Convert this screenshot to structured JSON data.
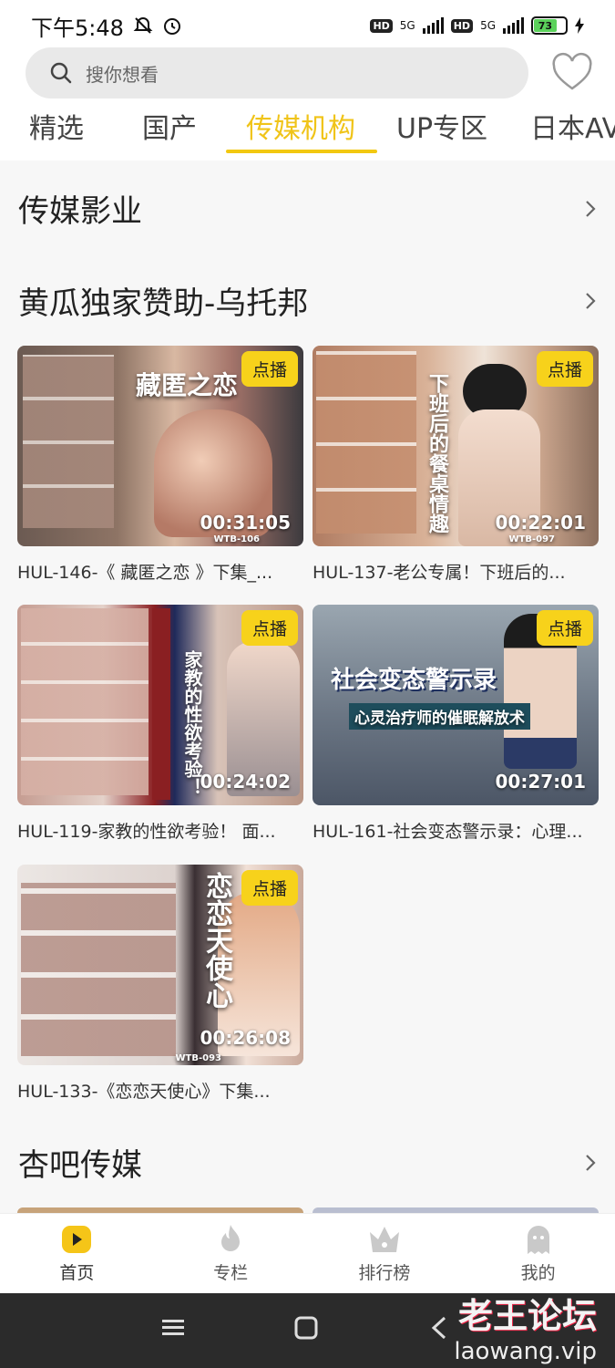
{
  "status": {
    "time": "下午5:48",
    "hd1": "HD",
    "net1": "5G",
    "hd2": "HD",
    "net2": "5G",
    "battery": "73"
  },
  "search": {
    "placeholder": "搜你想看"
  },
  "tabs": [
    {
      "label": "精选"
    },
    {
      "label": "国产"
    },
    {
      "label": "传媒机构"
    },
    {
      "label": "UP专区"
    },
    {
      "label": "日本AV"
    }
  ],
  "active_tab": "传媒机构",
  "sections": [
    {
      "title": "传媒影业"
    },
    {
      "title": "黄瓜独家赞助-乌托邦"
    },
    {
      "title": "杏吧传媒"
    }
  ],
  "videos": [
    {
      "badge": "点播",
      "duration": "00:31:05",
      "title": "HUL-146-《 藏匿之恋 》下集_...",
      "poster": "藏匿之恋",
      "code": "WTB-106"
    },
    {
      "badge": "点播",
      "duration": "00:22:01",
      "title": "HUL-137-老公专属！下班后的...",
      "poster": "下班后的餐桌情趣",
      "code": "WTB-097"
    },
    {
      "badge": "点播",
      "duration": "00:24:02",
      "title": "HUL-119-家教的性欲考验！ 面...",
      "poster": "家教的性欲考验！",
      "code": ""
    },
    {
      "badge": "点播",
      "duration": "00:27:01",
      "title": "HUL-161-社会变态警示录：心理...",
      "poster": "社会变态警示录",
      "code": "心灵治疗师的催眠解放术"
    },
    {
      "badge": "点播",
      "duration": "00:26:08",
      "title": "HUL-133-《恋恋天使心》下集...",
      "poster": "恋恋天使心",
      "code": "WTB-093"
    }
  ],
  "bottom_nav": [
    {
      "label": "首页",
      "icon": "home-play-icon"
    },
    {
      "label": "专栏",
      "icon": "flame-icon"
    },
    {
      "label": "排行榜",
      "icon": "crown-icon"
    },
    {
      "label": "我的",
      "icon": "ghost-user-icon"
    }
  ],
  "watermark": {
    "cn": "老王论坛",
    "en": "laowang.vip"
  },
  "colors": {
    "accent": "#f2c811",
    "badge": "#f7d21b",
    "background": "#f7f7f7"
  }
}
